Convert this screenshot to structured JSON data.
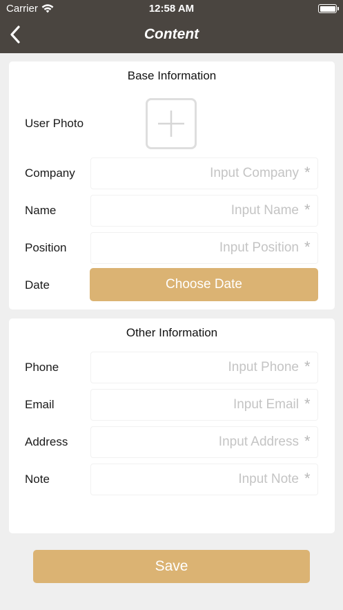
{
  "status_bar": {
    "carrier": "Carrier",
    "time": "12:58 AM",
    "wifi_icon": "wifi-icon",
    "battery_icon": "battery-icon"
  },
  "nav": {
    "title": "Content",
    "back_icon": "chevron-left-icon"
  },
  "base_info": {
    "title": "Base Information",
    "photo_label": "User Photo",
    "photo_icon": "plus-icon",
    "company_label": "Company",
    "company_placeholder": "Input Company",
    "name_label": "Name",
    "name_placeholder": "Input Name",
    "position_label": "Position",
    "position_placeholder": "Input Position",
    "date_label": "Date",
    "date_button": "Choose Date",
    "required_mark": "*"
  },
  "other_info": {
    "title": "Other Information",
    "phone_label": "Phone",
    "phone_placeholder": "Input Phone",
    "email_label": "Email",
    "email_placeholder": "Input Email",
    "address_label": "Address",
    "address_placeholder": "Input Address",
    "note_label": "Note",
    "note_placeholder": "Input Note",
    "required_mark": "*"
  },
  "save_button": "Save",
  "colors": {
    "header": "#4a4540",
    "accent": "#dbb373",
    "background": "#efefef",
    "card": "#ffffff"
  }
}
